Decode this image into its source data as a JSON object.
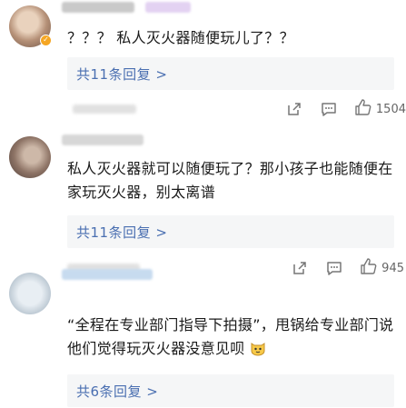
{
  "comments": [
    {
      "text": "？？？ 私人灭火器随便玩儿了？？",
      "reply_link": "共11条回复 >",
      "likes": "1504"
    },
    {
      "text": "私人灭火器就可以随便玩了？那小孩子也能随便在家玩灭火器，别太离谱",
      "reply_link": "共11条回复 >",
      "likes": "945"
    },
    {
      "text": "“全程在专业部门指导下拍摄”，甩锅给专业部门说他们觉得玩灭火器没意见呗",
      "reply_link": "共6条回复 >"
    }
  ],
  "icons": {
    "share": "share-icon",
    "comment": "comment-icon",
    "like": "thumbs-up-icon",
    "emoji": "cat-emoji-icon",
    "verified": "verified-badge-icon"
  },
  "colors": {
    "link": "#4a6fb1",
    "reply_bg": "#f5f6f7",
    "text": "#1a1a1a",
    "meta": "#666666"
  }
}
